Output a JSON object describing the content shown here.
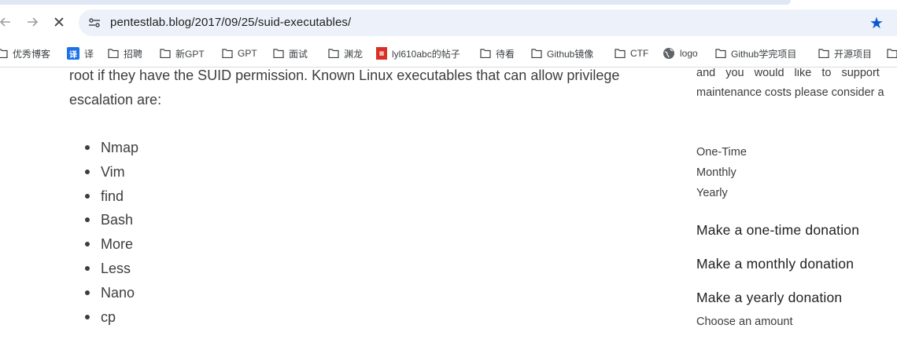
{
  "browser": {
    "url": "pentestlab.blog/2017/09/25/suid-executables/",
    "bookmarks": [
      {
        "label": "优秀博客",
        "icon": "folder-icon"
      },
      {
        "label": "译",
        "icon": "translate-icon"
      },
      {
        "label": "招聘",
        "icon": "folder-icon"
      },
      {
        "label": "新GPT",
        "icon": "folder-icon"
      },
      {
        "label": "GPT",
        "icon": "folder-icon"
      },
      {
        "label": "面试",
        "icon": "folder-icon"
      },
      {
        "label": "渊龙",
        "icon": "folder-icon"
      },
      {
        "label": "lyl610abc的帖子",
        "icon": "forum-icon"
      },
      {
        "label": "待看",
        "icon": "folder-icon"
      },
      {
        "label": "Github镜像",
        "icon": "folder-icon"
      },
      {
        "label": "CTF",
        "icon": "folder-icon"
      },
      {
        "label": "logo",
        "icon": "globe-icon"
      },
      {
        "label": "Github学完项目",
        "icon": "folder-icon"
      },
      {
        "label": "开源项目",
        "icon": "folder-icon"
      }
    ]
  },
  "article": {
    "paragraph_line1": "root if they have the SUID permission. Known Linux executables that can allow privilege",
    "paragraph_line2": "escalation are:",
    "executables": [
      "Nmap",
      "Vim",
      "find",
      "Bash",
      "More",
      "Less",
      "Nano",
      "cp"
    ]
  },
  "sidebar": {
    "text_line1": "and you would like to support",
    "text_line2": "maintenance costs please consider a",
    "frequency": [
      "One-Time",
      "Monthly",
      "Yearly"
    ],
    "donations": [
      "Make a one-time donation",
      "Make a monthly donation",
      "Make a yearly donation"
    ],
    "choose_amount": "Choose an amount"
  }
}
